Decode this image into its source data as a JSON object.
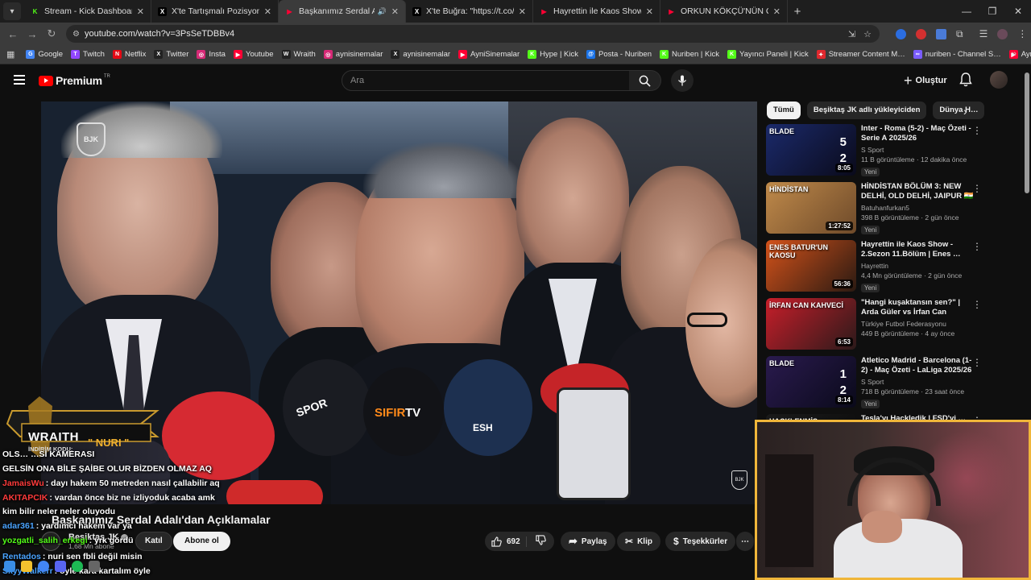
{
  "browser": {
    "tabs": [
      {
        "title": "Stream - Kick Dashboard",
        "favicon_color": "#53fc18",
        "favicon_glyph": "K",
        "active": false
      },
      {
        "title": "X'te Tartışmalı Pozisyonlar: \"FB …",
        "favicon_color": "#ffffff",
        "favicon_glyph": "X",
        "active": false
      },
      {
        "title": "Başkanımız Serdal Adalı'dan",
        "favicon_color": "#ff0033",
        "favicon_glyph": "▶",
        "active": true
      },
      {
        "title": "X'te Buğra: \"https://t.co/J9WM…",
        "favicon_color": "#ffffff",
        "favicon_glyph": "X",
        "active": false
      },
      {
        "title": "Hayrettin ile Kaos Show - 2.Sez…",
        "favicon_color": "#ff0033",
        "favicon_glyph": "▶",
        "active": false
      },
      {
        "title": "ORKUN KÖKÇÜ'NÜN GOLLERİ…",
        "favicon_color": "#ff0033",
        "favicon_glyph": "▶",
        "active": false
      }
    ],
    "new_tab_label": "+",
    "url": "youtube.com/watch?v=3PsSeTDBBv4",
    "bookmarks": [
      {
        "label": "Google",
        "color": "#4285f4",
        "glyph": "G"
      },
      {
        "label": "Twitch",
        "color": "#9146ff",
        "glyph": "T"
      },
      {
        "label": "Netflix",
        "color": "#e50914",
        "glyph": "N"
      },
      {
        "label": "Twitter",
        "color": "#222222",
        "glyph": "X"
      },
      {
        "label": "Insta",
        "color": "#d62976",
        "glyph": "◎"
      },
      {
        "label": "Youtube",
        "color": "#ff0033",
        "glyph": "▶"
      },
      {
        "label": "Wraith",
        "color": "#222222",
        "glyph": "W"
      },
      {
        "label": "aynisinemalar",
        "color": "#d62976",
        "glyph": "◎"
      },
      {
        "label": "aynisinemalar",
        "color": "#222222",
        "glyph": "X"
      },
      {
        "label": "AyniSinemalar",
        "color": "#ff0033",
        "glyph": "▶"
      },
      {
        "label": "Hype | Kick",
        "color": "#53fc18",
        "glyph": "K"
      },
      {
        "label": "Posta - Nuriben",
        "color": "#1a73e8",
        "glyph": "@"
      },
      {
        "label": "Nuriben | Kick",
        "color": "#53fc18",
        "glyph": "K"
      },
      {
        "label": "Yayıncı Paneli | Kick",
        "color": "#53fc18",
        "glyph": "K"
      },
      {
        "label": "Streamer Content M…",
        "color": "#e0282e",
        "glyph": "✦"
      },
      {
        "label": "nuriben - Channel S…",
        "color": "#7a5cff",
        "glyph": "∞"
      },
      {
        "label": "Aynı Sinemalar - Ça…",
        "color": "#ff0033",
        "glyph": "▶"
      }
    ]
  },
  "youtube": {
    "logo_text": "Premium",
    "logo_tr": "TR",
    "search_placeholder": "Ara",
    "create_label": "Oluştur",
    "chips": [
      "Tümü",
      "Beşiktaş JK adlı yükleyiciden",
      "Dünya H…"
    ],
    "video": {
      "title": "Başkanımız Serdal Adalı'dan Açıklamalar",
      "channel": "Beşiktaş JK",
      "subscribers": "1,68 Mn abone",
      "join_label": "Katıl",
      "subscribe_label": "Abone ol",
      "likes": "692",
      "share_label": "Paylaş",
      "clip_label": "Klip",
      "thanks_label": "Teşekkürler"
    },
    "recommendations": [
      {
        "title": "Inter - Roma (5-2) - Maç Özeti - Serie A 2025/26",
        "channel": "S Sport",
        "meta": "11 B görüntüleme · 12 dakika önce",
        "duration": "8:05",
        "badge": "Yeni",
        "thumb_colors": [
          "#1b2a6b",
          "#0a0a1a"
        ],
        "thumb_tag": "BLADE",
        "score": [
          "5",
          "2"
        ]
      },
      {
        "title": "HİNDİSTAN BÖLÜM 3: NEW DELHİ, OLD DELHİ, JAIPUR 🇮🇳",
        "channel": "Batuhanfurkan5",
        "meta": "398 B görüntüleme · 2 gün önce",
        "duration": "1:27:52",
        "badge": "Yeni",
        "thumb_colors": [
          "#c08a4a",
          "#6e4a2a"
        ],
        "thumb_tag": "HİNDİSTAN",
        "score": []
      },
      {
        "title": "Hayrettin ile Kaos Show - 2.Sezon 11.Bölüm | Enes …",
        "channel": "Hayrettin",
        "meta": "4,4 Mn görüntüleme · 2 gün önce",
        "duration": "56:36",
        "badge": "Yeni",
        "thumb_colors": [
          "#d4521a",
          "#2a1a12"
        ],
        "thumb_tag": "ENES BATUR'UN KAOSU",
        "score": []
      },
      {
        "title": "\"Hangi kuşaktansın sen?\" | Arda Güler vs İrfan Can Kahveci | …",
        "channel": "Türkiye Futbol Federasyonu",
        "meta": "449 B görüntüleme · 4 ay önce",
        "duration": "6:53",
        "badge": "",
        "thumb_colors": [
          "#c81e2a",
          "#2b1a1a"
        ],
        "thumb_tag": "İRFAN CAN KAHVECİ",
        "score": []
      },
      {
        "title": "Atletico Madrid - Barcelona (1-2) - Maç Özeti - LaLiga 2025/26",
        "channel": "S Sport",
        "meta": "718 B görüntüleme · 23 saat önce",
        "duration": "8:14",
        "badge": "Yeni",
        "thumb_colors": [
          "#2a1a4e",
          "#0a0a1a"
        ],
        "thumb_tag": "BLADE",
        "score": [
          "1",
          "2"
        ]
      },
      {
        "title": "Tesla'yı Hackledik | FSD'yi …",
        "channel": "",
        "meta": "",
        "duration": "",
        "badge": "",
        "thumb_colors": [
          "#1a1a1a",
          "#0a0a0a"
        ],
        "thumb_tag": "HACKLENMİŞ TESLA'LA",
        "score": []
      }
    ]
  },
  "overlay": {
    "wraith_brand": "WRAITH",
    "wraith_code_label": "İNDİRİM KODU:",
    "wraith_code": "\" NURI \"",
    "bjk_logo": "BJK",
    "chat": [
      {
        "user": "",
        "user_color": "#ffffff",
        "text": "OLS…                                  …Sİ KAMERASI"
      },
      {
        "user": "",
        "user_color": "#ffffff",
        "text": "GELSİN ONA BİLE ŞAİBE OLUR BİZDEN OLMAZ AQ"
      },
      {
        "user": "JamaisWu",
        "user_color": "#ff3b3b",
        "text": ": dayı hakem 50 metreden nasıl çallabilir aq"
      },
      {
        "user": "AKITAPCIK",
        "user_color": "#ff3b3b",
        "text": ": vardan önce biz ne izliyoduk acaba amk"
      },
      {
        "user": "",
        "user_color": "#ffffff",
        "text": "kim bilir neler neler oluyodu"
      },
      {
        "user": "adar361",
        "user_color": "#4aa3ff",
        "text": ": yardımcı hakem var ya"
      },
      {
        "user": "yozgatli_salih_erkegi",
        "user_color": "#53fc18",
        "text": ": yrk gördü"
      },
      {
        "user": "Rentados",
        "user_color": "#4aa3ff",
        "text": ": nuri sen fbli değil misin"
      },
      {
        "user": "SkyyWalkerr",
        "user_color": "#4aa3ff",
        "text": ": öyle kara kartalım öyle"
      }
    ]
  }
}
